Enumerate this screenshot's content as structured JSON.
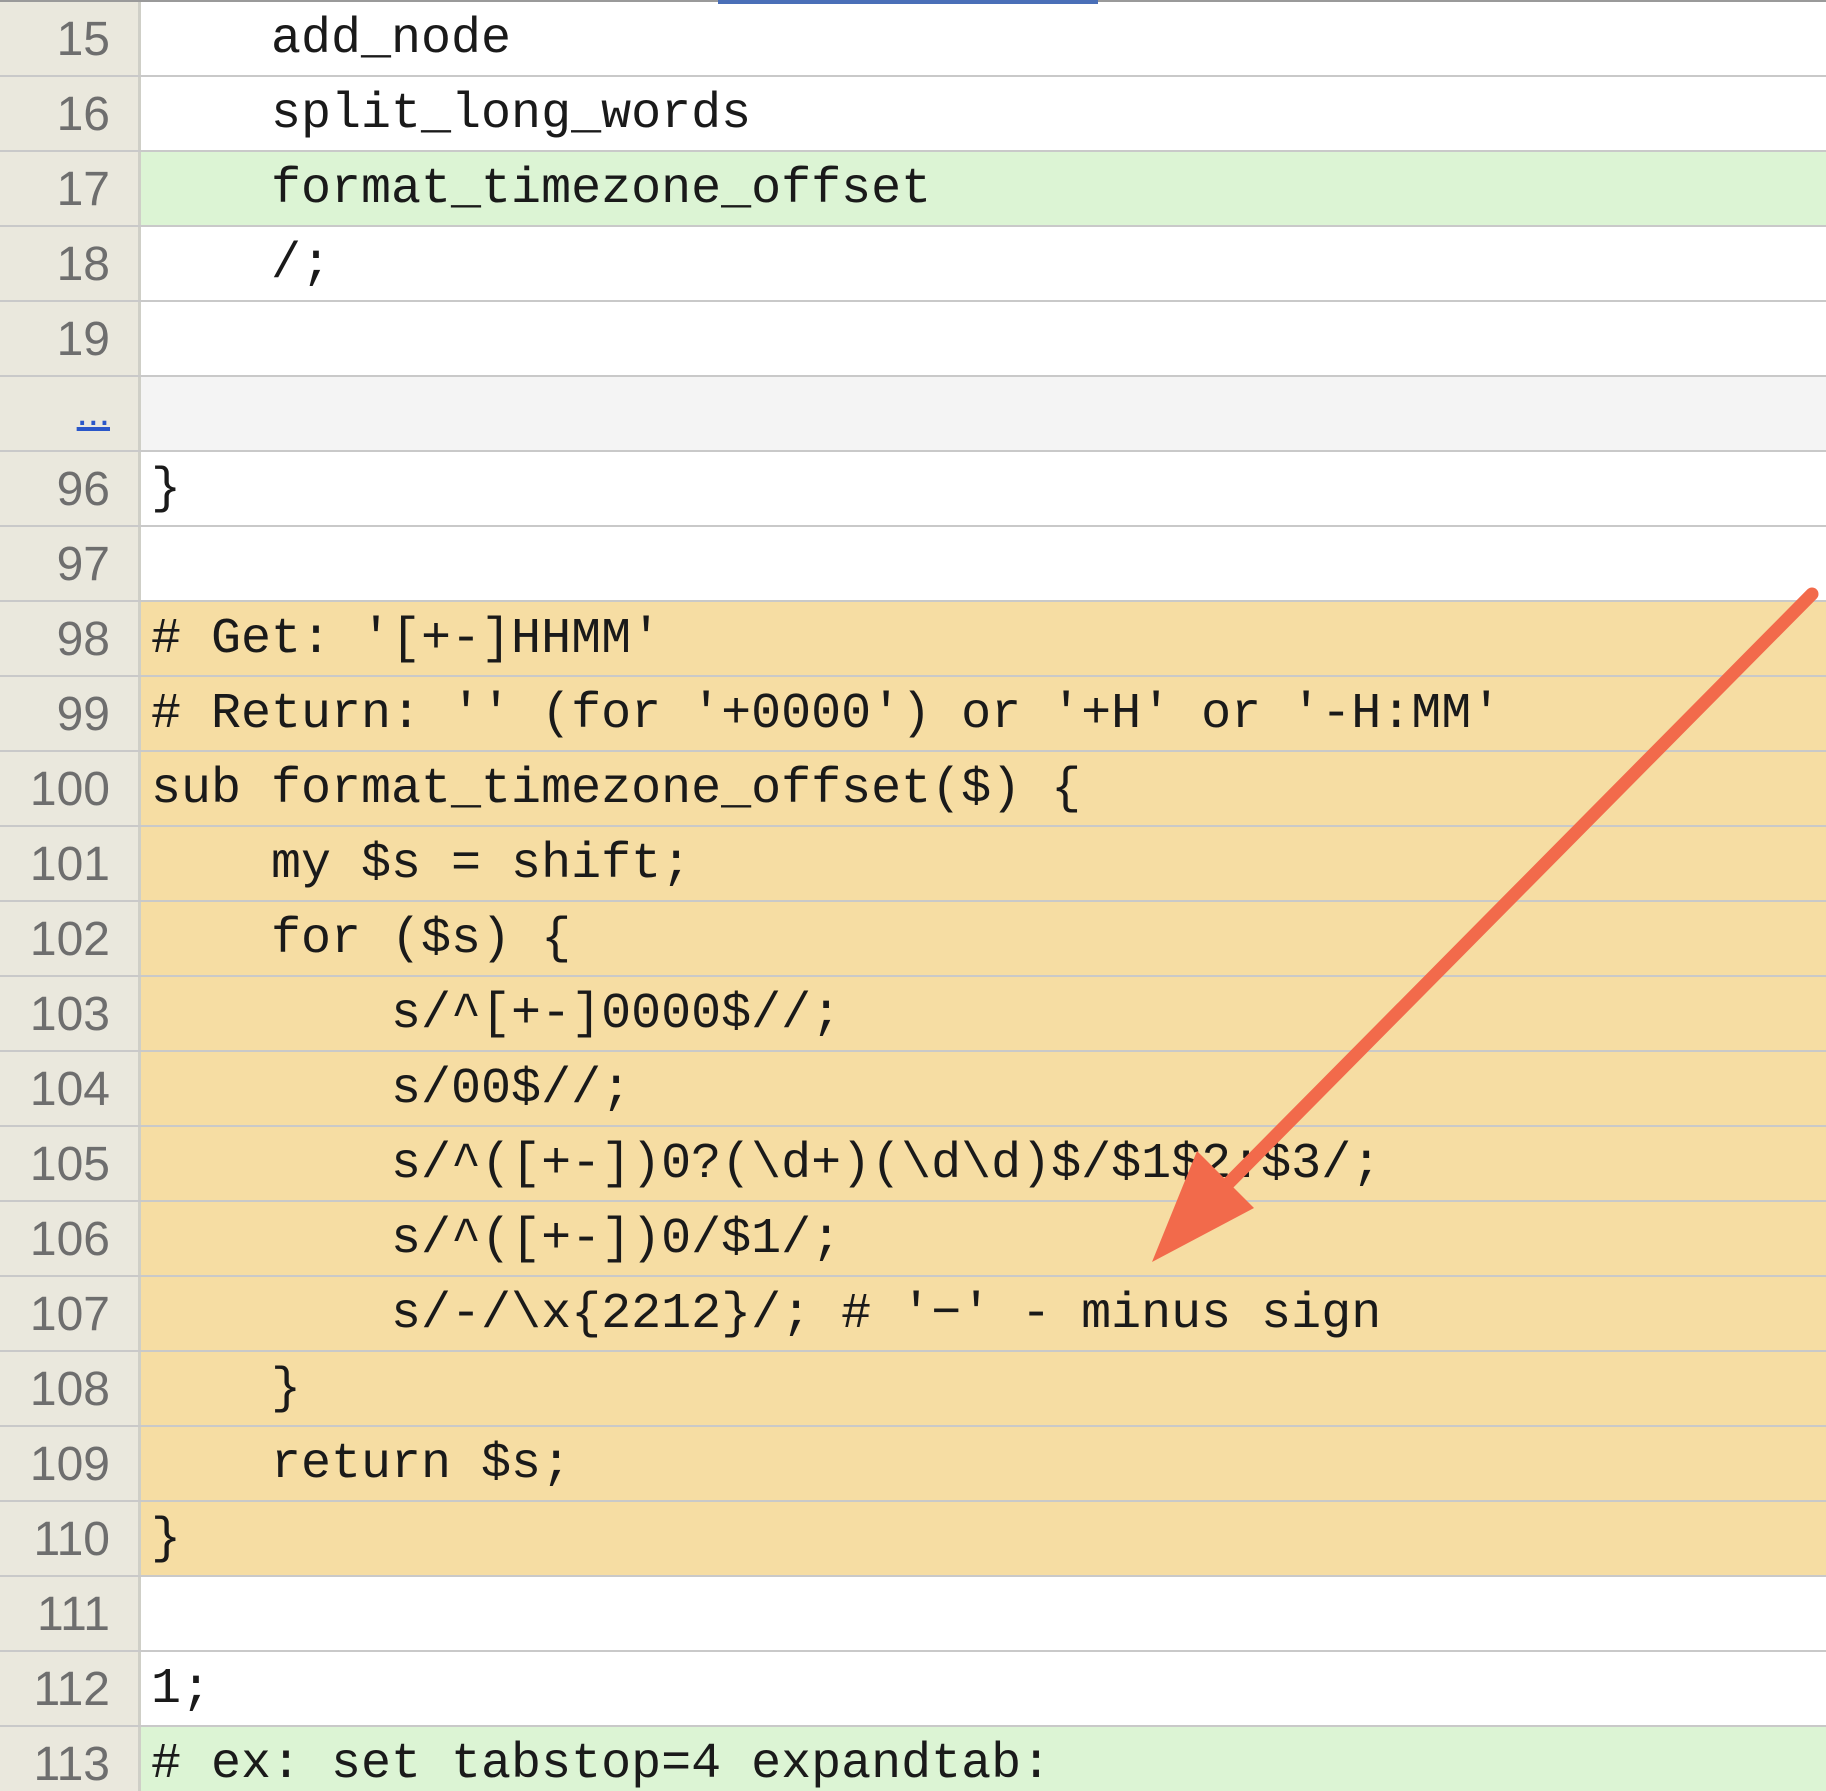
{
  "diff_view": {
    "gap_link": "...",
    "lines": [
      {
        "num": "15",
        "code": "    add_node",
        "hl": "plain"
      },
      {
        "num": "16",
        "code": "    split_long_words",
        "hl": "plain"
      },
      {
        "num": "17",
        "code": "    format_timezone_offset",
        "hl": "green"
      },
      {
        "num": "18",
        "code": "    /;",
        "hl": "plain"
      },
      {
        "num": "19",
        "code": "",
        "hl": "plain"
      },
      {
        "num": "...",
        "code": "",
        "hl": "gap"
      },
      {
        "num": "96",
        "code": "}",
        "hl": "plain"
      },
      {
        "num": "97",
        "code": "",
        "hl": "plain"
      },
      {
        "num": "98",
        "code": "# Get: '[+-]HHMM'",
        "hl": "yellow"
      },
      {
        "num": "99",
        "code": "# Return: '' (for '+0000') or '+H' or '-H:MM'",
        "hl": "yellow"
      },
      {
        "num": "100",
        "code": "sub format_timezone_offset($) {",
        "hl": "yellow"
      },
      {
        "num": "101",
        "code": "    my $s = shift;",
        "hl": "yellow"
      },
      {
        "num": "102",
        "code": "    for ($s) {",
        "hl": "yellow"
      },
      {
        "num": "103",
        "code": "        s/^[+-]0000$//;",
        "hl": "yellow"
      },
      {
        "num": "104",
        "code": "        s/00$//;",
        "hl": "yellow"
      },
      {
        "num": "105",
        "code": "        s/^([+-])0?(\\d+)(\\d\\d)$/$1$2:$3/;",
        "hl": "yellow"
      },
      {
        "num": "106",
        "code": "        s/^([+-])0/$1/;",
        "hl": "yellow"
      },
      {
        "num": "107",
        "code": "        s/-/\\x{2212}/; # '−' - minus sign",
        "hl": "yellow"
      },
      {
        "num": "108",
        "code": "    }",
        "hl": "yellow"
      },
      {
        "num": "109",
        "code": "    return $s;",
        "hl": "yellow"
      },
      {
        "num": "110",
        "code": "}",
        "hl": "yellow"
      },
      {
        "num": "111",
        "code": "",
        "hl": "plain"
      },
      {
        "num": "112",
        "code": "1;",
        "hl": "plain"
      },
      {
        "num": "113",
        "code": "# ex: set tabstop=4 expandtab:",
        "hl": "green"
      }
    ]
  },
  "annotation": {
    "arrow_color": "#f26a4b",
    "points_to": "minus sign"
  }
}
